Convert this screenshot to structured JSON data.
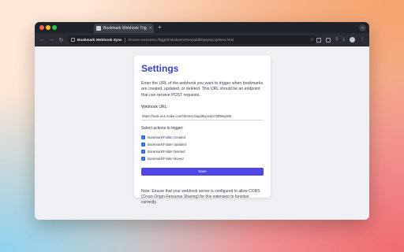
{
  "browser": {
    "tab_title": "Bookmark Webhook Trigger",
    "tab_close": "×",
    "new_tab": "+",
    "tab_menu": "⌄",
    "site_name": "Bookmark Webhook Sync",
    "url": "chrome-extension://bjjgbhmkaloemnhenpaldkfepepejcoptions.html",
    "back_icon": "←",
    "forward_icon": "→",
    "reload_icon": "↻",
    "star_icon": "☆"
  },
  "settings": {
    "title": "Settings",
    "description": "Enter the URL of the webhook you want to trigger when bookmarks are created, updated, or deleted. This URL should be an endpoint that can receive POST requests.",
    "webhook_label": "Webhook URL:",
    "webhook_value": "https://hook.eu1.make.com/hkcimvctoqd46yuvdccf3tf56ey9t0",
    "actions_label": "Select actions to trigger:",
    "actions": [
      {
        "label": "Bookmark/Folder Created",
        "checked": true
      },
      {
        "label": "Bookmark/Folder Updated",
        "checked": true
      },
      {
        "label": "Bookmark/Folder Deleted",
        "checked": true
      },
      {
        "label": "Bookmark/Folder Moved",
        "checked": true
      }
    ],
    "save_label": "Save",
    "note": "Note: Ensure that your webhook server is configured to allow CORS (Cross-Origin Resource Sharing) for this extension to function correctly."
  },
  "colors": {
    "accent": "#4f46e5",
    "title": "#3b3fb7",
    "checkbox": "#2563eb"
  }
}
